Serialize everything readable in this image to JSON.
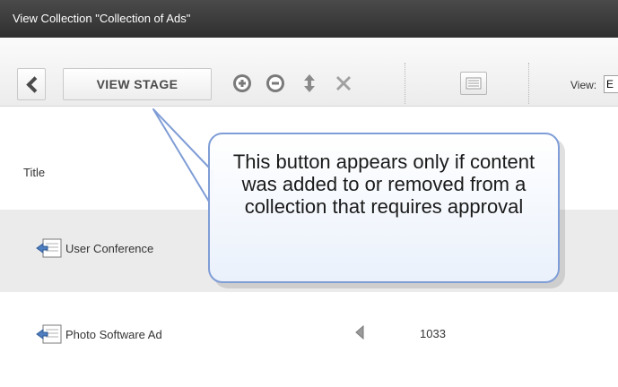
{
  "window": {
    "title": "View Collection \"Collection of Ads\""
  },
  "toolbar": {
    "back_icon": "chevron-left-icon",
    "view_stage_label": "VIEW STAGE",
    "add_icon": "plus-circle-icon",
    "remove_icon": "minus-circle-icon",
    "reorder_icon": "up-down-arrows-icon",
    "delete_icon": "x-icon",
    "list_icon": "list-icon",
    "view_label": "View:",
    "view_value": "E"
  },
  "table": {
    "columns": {
      "title": "Title"
    },
    "rows": [
      {
        "title": "User Conference",
        "icon": "document-icon"
      },
      {
        "title": "Photo Software Ad",
        "icon": "document-icon",
        "id": "1033"
      }
    ]
  },
  "callout": {
    "text": "This button appears only if content was added to or removed from a collection that requires approval",
    "border_color": "#7f9dd6"
  },
  "colors": {
    "titlebar": "#3a3a3a",
    "row_alt": "#ebebeb"
  }
}
